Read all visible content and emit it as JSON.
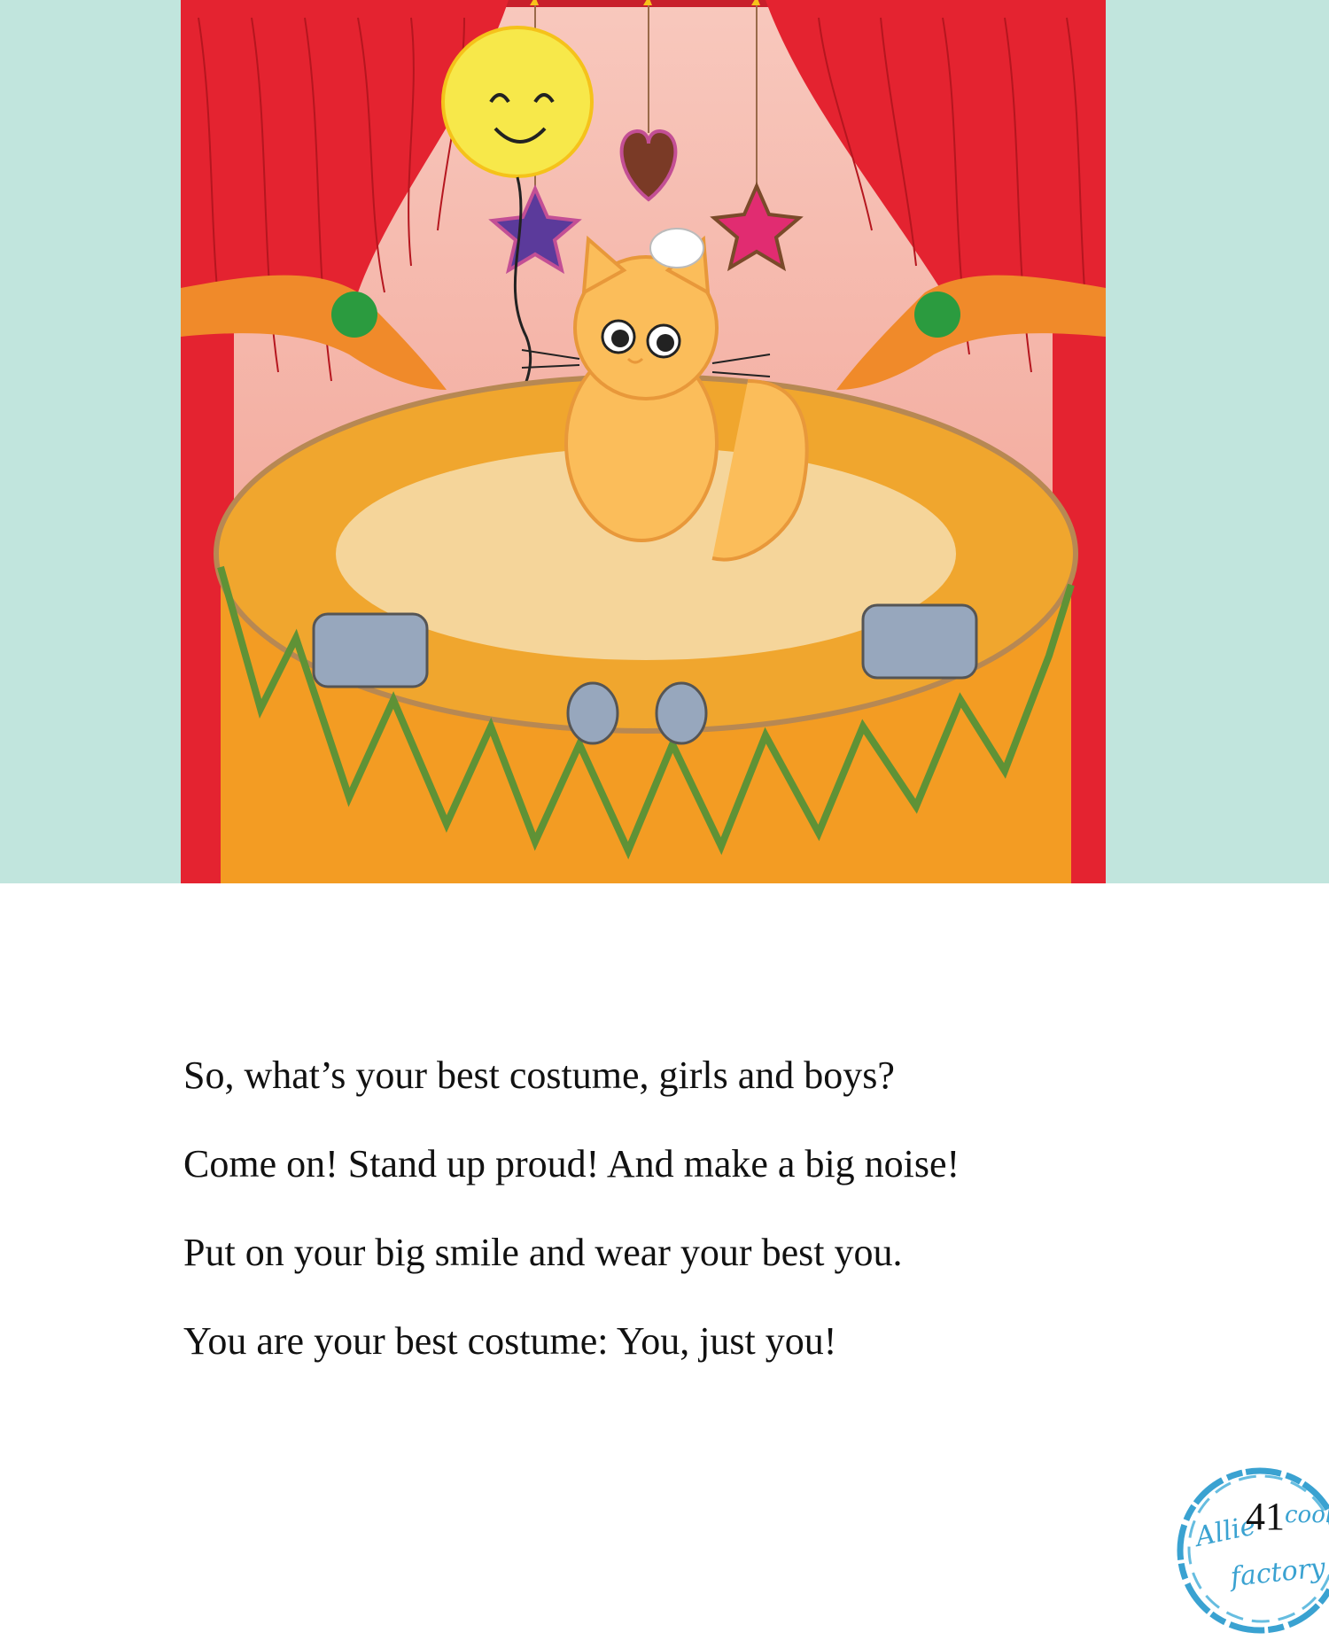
{
  "text": {
    "lines": [
      "So, what’s your best costume, girls and boys?",
      "Come on! Stand up proud! And make a big noise!",
      "Put on your big smile and wear your best you.",
      "You are your best costume: You, just you!"
    ]
  },
  "page": {
    "number": "41"
  },
  "stamp": {
    "text_line1": "Allie's cool",
    "text_line2": "factory"
  },
  "colors": {
    "background_band": "#c1e5dd",
    "curtain": "#e42330",
    "stage": "#f39c23",
    "bunting": "#5f9236",
    "cat": "#fbbd5a",
    "stamp": "#3aa2d1"
  }
}
